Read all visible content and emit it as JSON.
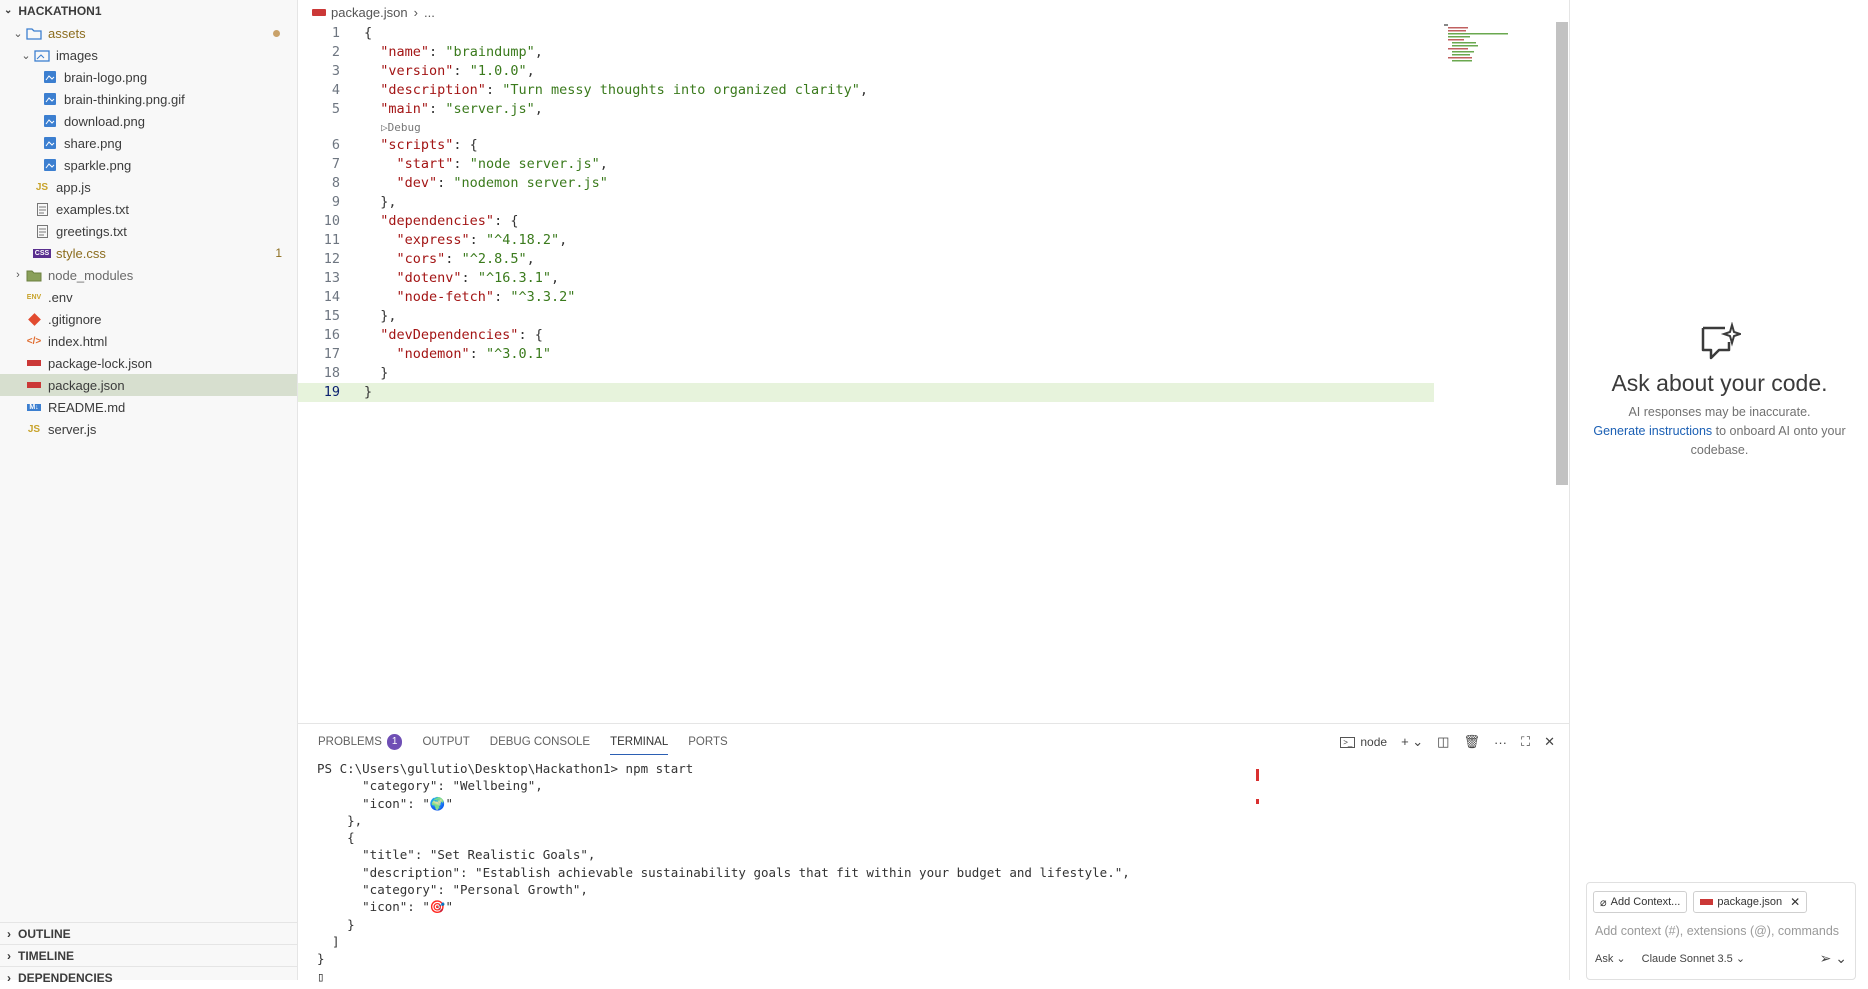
{
  "explorer": {
    "root": "HACKATHON1",
    "items": [
      {
        "label": "assets",
        "depth": 0,
        "kind": "folder-open",
        "icon": "folder-icon",
        "color": "#3c6fc2",
        "dot": true
      },
      {
        "label": "images",
        "depth": 1,
        "kind": "folder-open",
        "icon": "image-folder-icon",
        "color": "#3c6fc2"
      },
      {
        "label": "brain-logo.png",
        "depth": 2,
        "kind": "file",
        "icon": "image-file-icon",
        "color": "#3c6fc2"
      },
      {
        "label": "brain-thinking.png.gif",
        "depth": 2,
        "kind": "file",
        "icon": "image-file-icon",
        "color": "#3c6fc2"
      },
      {
        "label": "download.png",
        "depth": 2,
        "kind": "file",
        "icon": "image-file-icon",
        "color": "#3c6fc2"
      },
      {
        "label": "share.png",
        "depth": 2,
        "kind": "file",
        "icon": "image-file-icon",
        "color": "#3c6fc2"
      },
      {
        "label": "sparkle.png",
        "depth": 2,
        "kind": "file",
        "icon": "image-file-icon",
        "color": "#3c6fc2"
      },
      {
        "label": "app.js",
        "depth": 1,
        "kind": "file",
        "icon": "js-file-icon",
        "color": "#8c6d1f"
      },
      {
        "label": "examples.txt",
        "depth": 1,
        "kind": "file",
        "icon": "text-file-icon",
        "color": "#555555"
      },
      {
        "label": "greetings.txt",
        "depth": 1,
        "kind": "file",
        "icon": "text-file-icon",
        "color": "#555555"
      },
      {
        "label": "style.css",
        "depth": 1,
        "kind": "file",
        "icon": "css-file-icon",
        "color": "#8c6d1f",
        "badge": "1"
      },
      {
        "label": "node_modules",
        "depth": 0,
        "kind": "folder-closed",
        "icon": "node-modules-folder-icon",
        "color": "#6a6a6a"
      },
      {
        "label": ".env",
        "depth": 0,
        "kind": "file",
        "icon": "env-file-icon",
        "color": "#555555"
      },
      {
        "label": ".gitignore",
        "depth": 0,
        "kind": "file",
        "icon": "git-icon",
        "color": "#555555"
      },
      {
        "label": "index.html",
        "depth": 0,
        "kind": "file",
        "icon": "html-file-icon",
        "color": "#555555"
      },
      {
        "label": "package-lock.json",
        "depth": 0,
        "kind": "file",
        "icon": "npm-file-icon",
        "color": "#555555"
      },
      {
        "label": "package.json",
        "depth": 0,
        "kind": "file",
        "icon": "npm-file-icon",
        "color": "#555555",
        "selected": true
      },
      {
        "label": "README.md",
        "depth": 0,
        "kind": "file",
        "icon": "markdown-file-icon",
        "color": "#555555"
      },
      {
        "label": "server.js",
        "depth": 0,
        "kind": "file",
        "icon": "js-file-icon",
        "color": "#555555"
      }
    ],
    "sections": [
      "OUTLINE",
      "TIMELINE",
      "DEPENDENCIES"
    ]
  },
  "editor": {
    "breadcrumb_file": "package.json",
    "breadcrumb_more": "...",
    "codelens_label": "Debug",
    "lines": [
      {
        "n": "1",
        "indent": "",
        "tokens": [
          [
            "p",
            "{"
          ]
        ]
      },
      {
        "n": "2",
        "indent": "  ",
        "tokens": [
          [
            "k",
            "\"name\""
          ],
          [
            "p",
            ": "
          ],
          [
            "s",
            "\"braindump\""
          ],
          [
            "p",
            ","
          ]
        ]
      },
      {
        "n": "3",
        "indent": "  ",
        "tokens": [
          [
            "k",
            "\"version\""
          ],
          [
            "p",
            ": "
          ],
          [
            "s",
            "\"1.0.0\""
          ],
          [
            "p",
            ","
          ]
        ]
      },
      {
        "n": "4",
        "indent": "  ",
        "tokens": [
          [
            "k",
            "\"description\""
          ],
          [
            "p",
            ": "
          ],
          [
            "s",
            "\"Turn messy thoughts into organized clarity\""
          ],
          [
            "p",
            ","
          ]
        ]
      },
      {
        "n": "5",
        "indent": "  ",
        "tokens": [
          [
            "k",
            "\"main\""
          ],
          [
            "p",
            ": "
          ],
          [
            "s",
            "\"server.js\""
          ],
          [
            "p",
            ","
          ]
        ],
        "codelens_after": true
      },
      {
        "n": "6",
        "indent": "  ",
        "tokens": [
          [
            "k",
            "\"scripts\""
          ],
          [
            "p",
            ": {"
          ]
        ]
      },
      {
        "n": "7",
        "indent": "    ",
        "tokens": [
          [
            "k",
            "\"start\""
          ],
          [
            "p",
            ": "
          ],
          [
            "s",
            "\"node server.js\""
          ],
          [
            "p",
            ","
          ]
        ]
      },
      {
        "n": "8",
        "indent": "    ",
        "tokens": [
          [
            "k",
            "\"dev\""
          ],
          [
            "p",
            ": "
          ],
          [
            "s",
            "\"nodemon server.js\""
          ]
        ]
      },
      {
        "n": "9",
        "indent": "  ",
        "tokens": [
          [
            "p",
            "},"
          ]
        ]
      },
      {
        "n": "10",
        "indent": "  ",
        "tokens": [
          [
            "k",
            "\"dependencies\""
          ],
          [
            "p",
            ": {"
          ]
        ]
      },
      {
        "n": "11",
        "indent": "    ",
        "tokens": [
          [
            "k",
            "\"express\""
          ],
          [
            "p",
            ": "
          ],
          [
            "s",
            "\"^4.18.2\""
          ],
          [
            "p",
            ","
          ]
        ]
      },
      {
        "n": "12",
        "indent": "    ",
        "tokens": [
          [
            "k",
            "\"cors\""
          ],
          [
            "p",
            ": "
          ],
          [
            "s",
            "\"^2.8.5\""
          ],
          [
            "p",
            ","
          ]
        ]
      },
      {
        "n": "13",
        "indent": "    ",
        "tokens": [
          [
            "k",
            "\"dotenv\""
          ],
          [
            "p",
            ": "
          ],
          [
            "s",
            "\"^16.3.1\""
          ],
          [
            "p",
            ","
          ]
        ]
      },
      {
        "n": "14",
        "indent": "    ",
        "tokens": [
          [
            "k",
            "\"node-fetch\""
          ],
          [
            "p",
            ": "
          ],
          [
            "s",
            "\"^3.3.2\""
          ]
        ]
      },
      {
        "n": "15",
        "indent": "  ",
        "tokens": [
          [
            "p",
            "},"
          ]
        ]
      },
      {
        "n": "16",
        "indent": "  ",
        "tokens": [
          [
            "k",
            "\"devDependencies\""
          ],
          [
            "p",
            ": {"
          ]
        ]
      },
      {
        "n": "17",
        "indent": "    ",
        "tokens": [
          [
            "k",
            "\"nodemon\""
          ],
          [
            "p",
            ": "
          ],
          [
            "s",
            "\"^3.0.1\""
          ]
        ]
      },
      {
        "n": "18",
        "indent": "  ",
        "tokens": [
          [
            "p",
            "}"
          ]
        ]
      },
      {
        "n": "19",
        "indent": "",
        "tokens": [
          [
            "p",
            "}"
          ]
        ],
        "current": true
      }
    ]
  },
  "panel": {
    "tabs": [
      {
        "label": "PROBLEMS",
        "count": "1"
      },
      {
        "label": "OUTPUT"
      },
      {
        "label": "DEBUG CONSOLE"
      },
      {
        "label": "TERMINAL",
        "active": true
      },
      {
        "label": "PORTS"
      }
    ],
    "terminal_name": "node",
    "terminal_lines": [
      "PS C:\\Users\\gullutio\\Desktop\\Hackathon1> npm start",
      "      \"category\": \"Wellbeing\",",
      "      \"icon\": \"🌍\"",
      "    },",
      "    {",
      "      \"title\": \"Set Realistic Goals\",",
      "      \"description\": \"Establish achievable sustainability goals that fit within your budget and lifestyle.\",",
      "      \"category\": \"Personal Growth\",",
      "      \"icon\": \"🎯\"",
      "    }",
      "  ]",
      "}",
      "▯"
    ]
  },
  "chat": {
    "title": "Ask about your code.",
    "disclaimer": "AI responses may be inaccurate.",
    "link": "Generate instructions",
    "after_link": " to onboard AI onto your codebase.",
    "add_context": "Add Context...",
    "context_file": "package.json",
    "placeholder": "Add context (#), extensions (@), commands",
    "mode": "Ask",
    "model": "Claude Sonnet 3.5"
  }
}
